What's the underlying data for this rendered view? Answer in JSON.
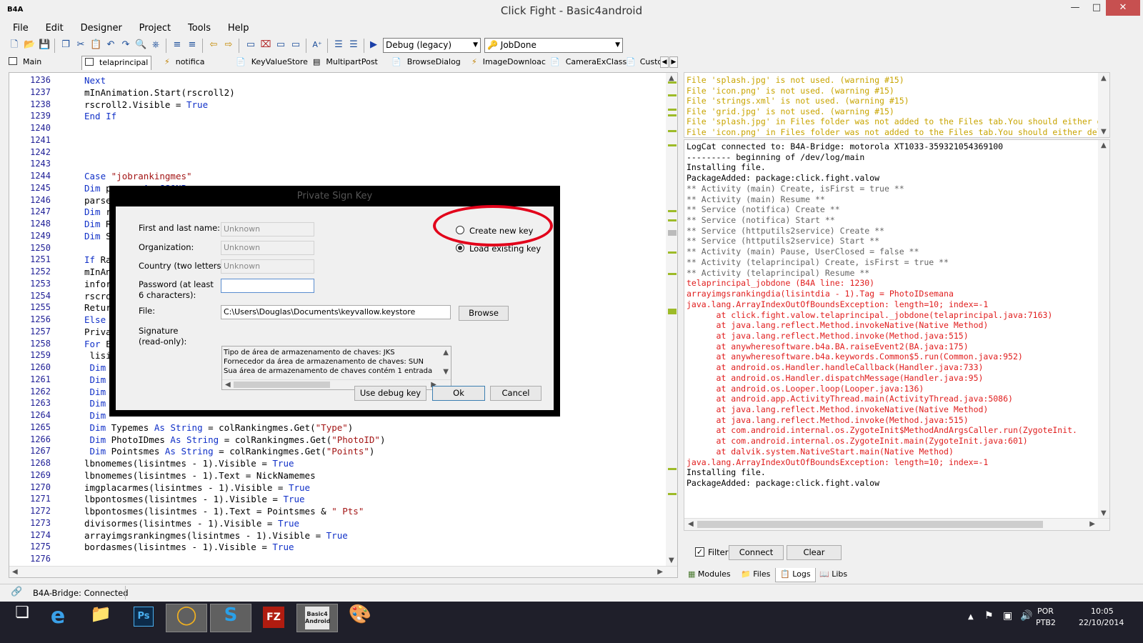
{
  "window": {
    "title": "Click Fight - Basic4android",
    "app_badge": "B4A"
  },
  "menu": [
    "File",
    "Edit",
    "Designer",
    "Project",
    "Tools",
    "Help"
  ],
  "toolbar": {
    "mode": "Debug (legacy)",
    "sub": "JobDone"
  },
  "tabs": [
    "Main",
    "telaprincipal",
    "notifica",
    "KeyValueStore",
    "MultipartPost",
    "BrowseDialog",
    "ImageDownloac",
    "CameraExClass",
    "Custc"
  ],
  "editor": {
    "lines": [
      {
        "n": "1236",
        "t": "Next"
      },
      {
        "n": "1237",
        "t": "mInAnimation.Start(rscroll2)"
      },
      {
        "n": "1238",
        "t": "rscroll2.Visible = True"
      },
      {
        "n": "1239",
        "t": "End If"
      },
      {
        "n": "1240",
        "t": ""
      },
      {
        "n": "1241",
        "t": ""
      },
      {
        "n": "1242",
        "t": ""
      },
      {
        "n": "1243",
        "t": ""
      },
      {
        "n": "1244",
        "t": "Case \"jobrankingmes\""
      },
      {
        "n": "1245",
        "t": "Dim parser As JSONParser"
      },
      {
        "n": "1246",
        "t": "parse"
      },
      {
        "n": "1247",
        "t": "Dim r"
      },
      {
        "n": "1248",
        "t": "Dim R"
      },
      {
        "n": "1249",
        "t": "Dim S"
      },
      {
        "n": "1250",
        "t": ""
      },
      {
        "n": "1251",
        "t": "If Ra"
      },
      {
        "n": "1252",
        "t": "mInAn"
      },
      {
        "n": "1253",
        "t": "infor"
      },
      {
        "n": "1254",
        "t": "rscro"
      },
      {
        "n": "1255",
        "t": "Retur"
      },
      {
        "n": "1256",
        "t": "Else"
      },
      {
        "n": "1257",
        "t": "Priva"
      },
      {
        "n": "1258",
        "t": "For E"
      },
      {
        "n": "1259",
        "t": " lisi"
      },
      {
        "n": "1260",
        "t": " Dim"
      },
      {
        "n": "1261",
        "t": " Dim"
      },
      {
        "n": "1262",
        "t": " Dim"
      },
      {
        "n": "1263",
        "t": " Dim"
      },
      {
        "n": "1264",
        "t": " Dim"
      },
      {
        "n": "1265",
        "t": " Dim Typemes As String = colRankingmes.Get(\"Type\")"
      },
      {
        "n": "1266",
        "t": " Dim PhotoIDmes As String = colRankingmes.Get(\"PhotoID\")"
      },
      {
        "n": "1267",
        "t": " Dim Pointsmes As String = colRankingmes.Get(\"Points\")"
      },
      {
        "n": "1268",
        "t": "lbnomemes(lisintmes - 1).Visible = True"
      },
      {
        "n": "1269",
        "t": "lbnomemes(lisintmes - 1).Text = NickNamemes"
      },
      {
        "n": "1270",
        "t": "imgplacarmes(lisintmes - 1).Visible = True"
      },
      {
        "n": "1271",
        "t": "lbpontosmes(lisintmes - 1).Visible = True"
      },
      {
        "n": "1272",
        "t": "lbpontosmes(lisintmes - 1).Text = Pointsmes & \" Pts\""
      },
      {
        "n": "1273",
        "t": "divisormes(lisintmes - 1).Visible = True"
      },
      {
        "n": "1274",
        "t": "arrayimgsrankingmes(lisintmes - 1).Visible = True"
      },
      {
        "n": "1275",
        "t": "bordasmes(lisintmes - 1).Visible = True"
      },
      {
        "n": "1276",
        "t": ""
      }
    ]
  },
  "dialog": {
    "title": "Private Sign Key",
    "labels": {
      "name": "First and last name:",
      "org": "Organization:",
      "country": "Country (two letters):",
      "password_1": "Password (at least",
      "password_2": "6 characters):",
      "file": "File:",
      "signature_1": "Signature",
      "signature_2": "(read-only):"
    },
    "fields": {
      "name": "Unknown",
      "org": "Unknown",
      "country": "Unknown",
      "password": "",
      "file": "C:\\Users\\Douglas\\Documents\\keyvallow.keystore"
    },
    "radios": {
      "create": "Create new key",
      "load": "Load existing key",
      "selected": "load"
    },
    "signature_lines": [
      "Tipo de área de armazenamento de chaves: JKS",
      "Fornecedor da área de armazenamento de chaves: SUN",
      "Sua área de armazenamento de chaves contém 1 entrada"
    ],
    "buttons": {
      "browse": "Browse",
      "debug": "Use debug key",
      "ok": "Ok",
      "cancel": "Cancel"
    }
  },
  "logs": {
    "warnings": [
      "File 'splash.jpg' is not used. (warning #15)",
      "File 'icon.png' is not used. (warning #15)",
      "File 'strings.xml' is not used. (warning #15)",
      "File 'grid.jpg' is not used. (warning #15)",
      "File 'splash.jpg' in Files folder was not added to the Files tab.You should either d",
      "File 'icon.png' in Files folder was not added to the Files tab.You should either del"
    ],
    "main": [
      {
        "c": "info",
        "t": "LogCat connected to: B4A-Bridge: motorola XT1033-359321054369100"
      },
      {
        "c": "info",
        "t": "--------- beginning of /dev/log/main"
      },
      {
        "c": "info",
        "t": "Installing file."
      },
      {
        "c": "info",
        "t": "PackageAdded: package:click.fight.valow"
      },
      {
        "c": "grey",
        "t": "** Activity (main) Create, isFirst = true **"
      },
      {
        "c": "grey",
        "t": "** Activity (main) Resume **"
      },
      {
        "c": "grey",
        "t": "** Service (notifica) Create **"
      },
      {
        "c": "grey",
        "t": "** Service (notifica) Start **"
      },
      {
        "c": "grey",
        "t": "** Service (httputils2service) Create **"
      },
      {
        "c": "grey",
        "t": "** Service (httputils2service) Start **"
      },
      {
        "c": "grey",
        "t": "** Activity (main) Pause, UserClosed = false **"
      },
      {
        "c": "grey",
        "t": "** Activity (telaprincipal) Create, isFirst = true **"
      },
      {
        "c": "grey",
        "t": "** Activity (telaprincipal) Resume **"
      },
      {
        "c": "err",
        "t": "telaprincipal_jobdone (B4A line: 1230)"
      },
      {
        "c": "err",
        "t": "arrayimgsrankingdia(lisintdia - 1).Tag = PhotoIDsemana"
      },
      {
        "c": "err",
        "t": "java.lang.ArrayIndexOutOfBoundsException: length=10; index=-1"
      },
      {
        "c": "err",
        "t": "\tat click.fight.valow.telaprincipal._jobdone(telaprincipal.java:7163)"
      },
      {
        "c": "err",
        "t": "\tat java.lang.reflect.Method.invokeNative(Native Method)"
      },
      {
        "c": "err",
        "t": "\tat java.lang.reflect.Method.invoke(Method.java:515)"
      },
      {
        "c": "err",
        "t": "\tat anywheresoftware.b4a.BA.raiseEvent2(BA.java:175)"
      },
      {
        "c": "err",
        "t": "\tat anywheresoftware.b4a.keywords.Common$5.run(Common.java:952)"
      },
      {
        "c": "err",
        "t": "\tat android.os.Handler.handleCallback(Handler.java:733)"
      },
      {
        "c": "err",
        "t": "\tat android.os.Handler.dispatchMessage(Handler.java:95)"
      },
      {
        "c": "err",
        "t": "\tat android.os.Looper.loop(Looper.java:136)"
      },
      {
        "c": "err",
        "t": "\tat android.app.ActivityThread.main(ActivityThread.java:5086)"
      },
      {
        "c": "err",
        "t": "\tat java.lang.reflect.Method.invokeNative(Native Method)"
      },
      {
        "c": "err",
        "t": "\tat java.lang.reflect.Method.invoke(Method.java:515)"
      },
      {
        "c": "err",
        "t": "\tat com.android.internal.os.ZygoteInit$MethodAndArgsCaller.run(ZygoteInit."
      },
      {
        "c": "err",
        "t": "\tat com.android.internal.os.ZygoteInit.main(ZygoteInit.java:601)"
      },
      {
        "c": "err",
        "t": "\tat dalvik.system.NativeStart.main(Native Method)"
      },
      {
        "c": "err",
        "t": "java.lang.ArrayIndexOutOfBoundsException: length=10; index=-1"
      },
      {
        "c": "info",
        "t": "Installing file."
      },
      {
        "c": "info",
        "t": "PackageAdded: package:click.fight.valow"
      }
    ],
    "filter_label": "Filter",
    "connect": "Connect",
    "clear": "Clear"
  },
  "right_tabs": [
    "Modules",
    "Files",
    "Logs",
    "Libs"
  ],
  "status": "B4A-Bridge: Connected",
  "taskbar": {
    "lang1": "POR",
    "lang2": "PTB2",
    "time": "10:05",
    "date": "22/10/2014",
    "badge_fz": "FZ",
    "badge_ps": "Ps",
    "badge_b4a": "Basic4 Android"
  },
  "colors": {
    "warn": "#c8a400",
    "error": "#e01d1d",
    "keyword": "#1030c8",
    "highlight": "#e2001a"
  }
}
